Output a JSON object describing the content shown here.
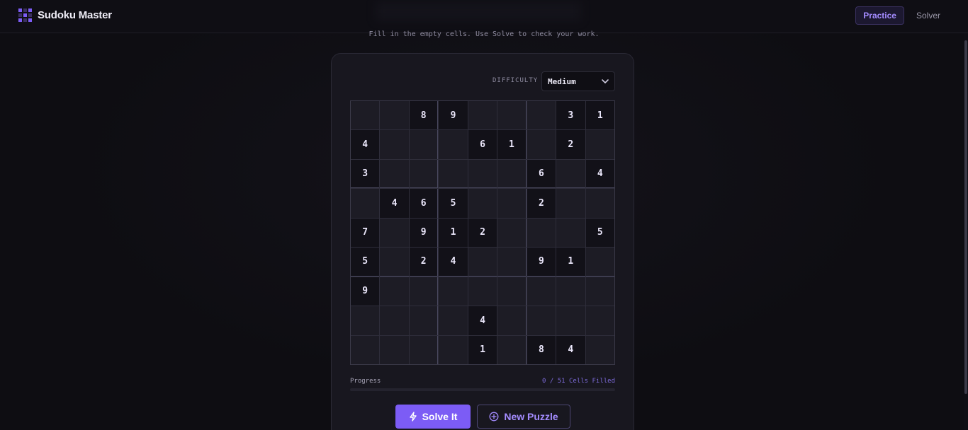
{
  "header": {
    "brand": "Sudoku Master",
    "nav": [
      {
        "label": "Practice",
        "active": true
      },
      {
        "label": "Solver",
        "active": false
      }
    ]
  },
  "subtitle": "Fill in the empty cells. Use Solve to check your work.",
  "difficulty": {
    "label": "DIFFICULTY",
    "selected": "Medium"
  },
  "board": [
    [
      0,
      0,
      8,
      9,
      0,
      0,
      0,
      3,
      1
    ],
    [
      4,
      0,
      0,
      0,
      6,
      1,
      0,
      2,
      0
    ],
    [
      3,
      0,
      0,
      0,
      0,
      0,
      6,
      0,
      4
    ],
    [
      0,
      4,
      6,
      5,
      0,
      0,
      2,
      0,
      0
    ],
    [
      7,
      0,
      9,
      1,
      2,
      0,
      0,
      0,
      5
    ],
    [
      5,
      0,
      2,
      4,
      0,
      0,
      9,
      1,
      0
    ],
    [
      9,
      0,
      0,
      0,
      0,
      0,
      0,
      0,
      0
    ],
    [
      0,
      0,
      0,
      0,
      4,
      0,
      0,
      0,
      0
    ],
    [
      0,
      0,
      0,
      0,
      1,
      0,
      8,
      4,
      0
    ]
  ],
  "progress": {
    "label": "Progress",
    "count_text": "0 / 51 Cells Filled",
    "filled": 0,
    "total": 51
  },
  "actions": {
    "solve_label": "Solve It",
    "new_label": "New Puzzle"
  },
  "colors": {
    "accent": "#7c5cf5",
    "background": "#0e0d12",
    "card": "#18171f"
  },
  "icons": [
    "logo-grid-icon",
    "chevron-down-icon",
    "bolt-icon",
    "plus-circle-icon"
  ]
}
